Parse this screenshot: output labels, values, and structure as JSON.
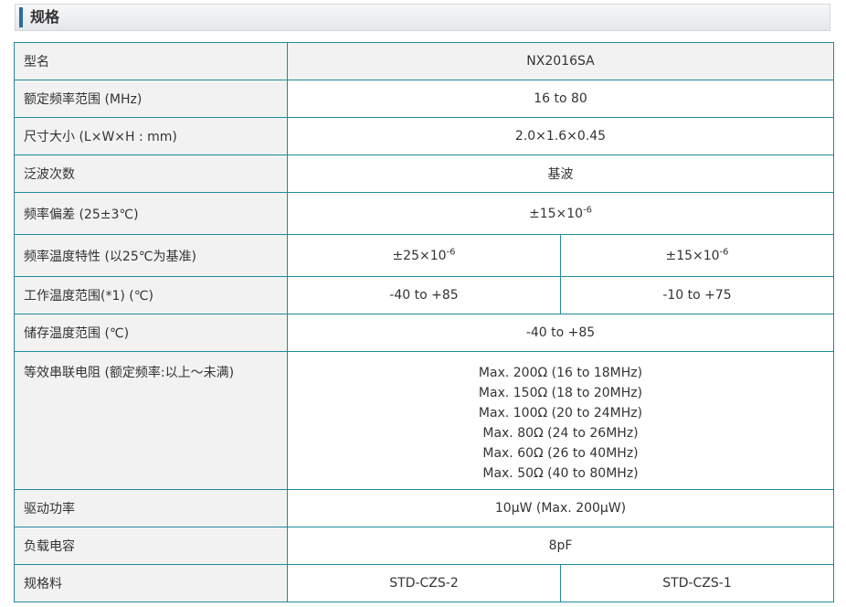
{
  "section": {
    "title": "规格"
  },
  "rows": {
    "model": {
      "label": "型名",
      "value": "NX2016SA"
    },
    "freq_range": {
      "label": "额定频率范围 (MHz)",
      "value": "16 to 80"
    },
    "size": {
      "label": "尺寸大小 (L×W×H : mm)",
      "value": "2.0×1.6×0.45"
    },
    "overtone": {
      "label": "泛波次数",
      "value": "基波"
    },
    "freq_tolerance": {
      "label": "频率偏差 (25±3℃)",
      "value_base": "±15×10",
      "value_exp": "-6"
    },
    "freq_temp": {
      "label": "频率温度特性 (以25℃为基准)",
      "col1_base": "±25×10",
      "col1_exp": "-6",
      "col2_base": "±15×10",
      "col2_exp": "-6"
    },
    "op_temp": {
      "label": "工作温度范围(*1) (℃)",
      "col1": "-40 to +85",
      "col2": "-10 to +75"
    },
    "storage_temp": {
      "label": "储存温度范围 (℃)",
      "value": "-40 to +85"
    },
    "esr": {
      "label": "等效串联电阻 (额定频率:以上～未满)",
      "lines": [
        "Max. 200Ω (16 to 18MHz)",
        "Max. 150Ω (18 to 20MHz)",
        "Max. 100Ω (20 to 24MHz)",
        "Max. 80Ω (24 to 26MHz)",
        "Max. 60Ω (26 to 40MHz)",
        "Max. 50Ω (40 to 80MHz)"
      ]
    },
    "drive_level": {
      "label": "驱动功率",
      "value": "10μW (Max. 200μW)"
    },
    "load_cap": {
      "label": "负载电容",
      "value": "8pF"
    },
    "spec_no": {
      "label": "规格料",
      "col1": "STD-CZS-2",
      "col2": "STD-CZS-1"
    }
  }
}
